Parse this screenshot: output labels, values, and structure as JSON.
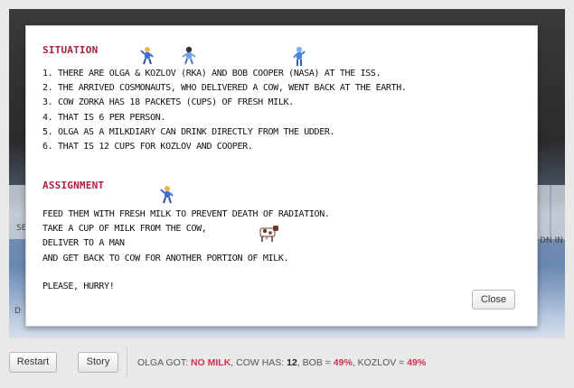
{
  "modal": {
    "situation_title": "SITUATION",
    "situation_lines": [
      "1. THERE ARE OLGA & KOZLOV (RKA) AND BOB COOPER (NASA) AT THE ISS.",
      "2. THE ARRIVED COSMONAUTS, WHO DELIVERED A COW, WENT BACK AT THE EARTH.",
      "3. COW ZORKA HAS 18 PACKETS (CUPS) OF FRESH MILK.",
      "4. THAT IS 6 PER PERSON.",
      "5. OLGA AS A MILKDIARY CAN DRINK DIRECTLY FROM THE UDDER.",
      "6. THAT IS 12 CUPS FOR KOZLOV AND COOPER."
    ],
    "assignment_title": "ASSIGNMENT",
    "assignment_lines": [
      "FEED THEM WITH FRESH MILK TO PREVENT  DEATH OF RADIATION.",
      "TAKE A CUP OF MILK FROM THE COW,",
      "DELIVER TO A MAN",
      "AND GET BACK TO COW FOR ANOTHER PORTION OF MILK."
    ],
    "closing_line": "PLEASE, HURRY!",
    "close_label": "Close"
  },
  "controls": {
    "restart_label": "Restart",
    "story_label": "Story"
  },
  "status": {
    "olga_label": "OLGA GOT:",
    "olga_value": "NO MILK",
    "cow_label": ", COW HAS:",
    "cow_value": "12",
    "bob_label": ", BOB =",
    "bob_value": "49%",
    "kozlov_label": ", KOZLOV =",
    "kozlov_value": "49%"
  },
  "background": {
    "edge_left_1": "SE",
    "edge_left_2": "D",
    "edge_right": "DN IN"
  },
  "icons": [
    "olga-sprite-icon",
    "kozlov-sprite-icon",
    "bob-sprite-icon",
    "cow-sprite-icon"
  ],
  "colors": {
    "heading": "#b21d3c",
    "status_highlight": "#d1334f"
  }
}
